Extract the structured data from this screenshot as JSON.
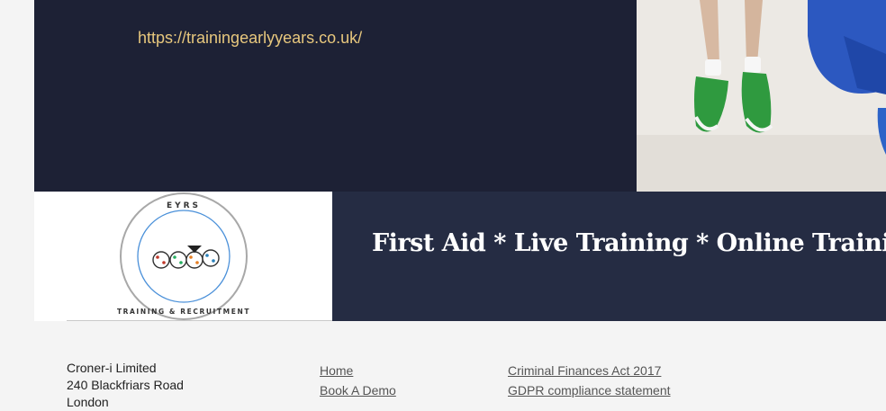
{
  "header": {
    "link_text": "https://trainingearlyyears.co.uk/"
  },
  "logo": {
    "top_text": "EYRS",
    "bottom_text": "TRAINING & RECRUITMENT"
  },
  "banner": {
    "text": "First Aid * Live Training * Online Training * Recruitment"
  },
  "footer": {
    "address_lines": [
      "Croner-i Limited",
      "240 Blackfriars Road",
      "London"
    ],
    "nav_col1": [
      "Home",
      "Book A Demo"
    ],
    "nav_col2": [
      "Criminal Finances Act 2017",
      "GDPR compliance statement"
    ]
  },
  "colors": {
    "header_bg": "#1d2135",
    "banner_bg": "#252c43",
    "link_gold": "#e7c77d"
  }
}
